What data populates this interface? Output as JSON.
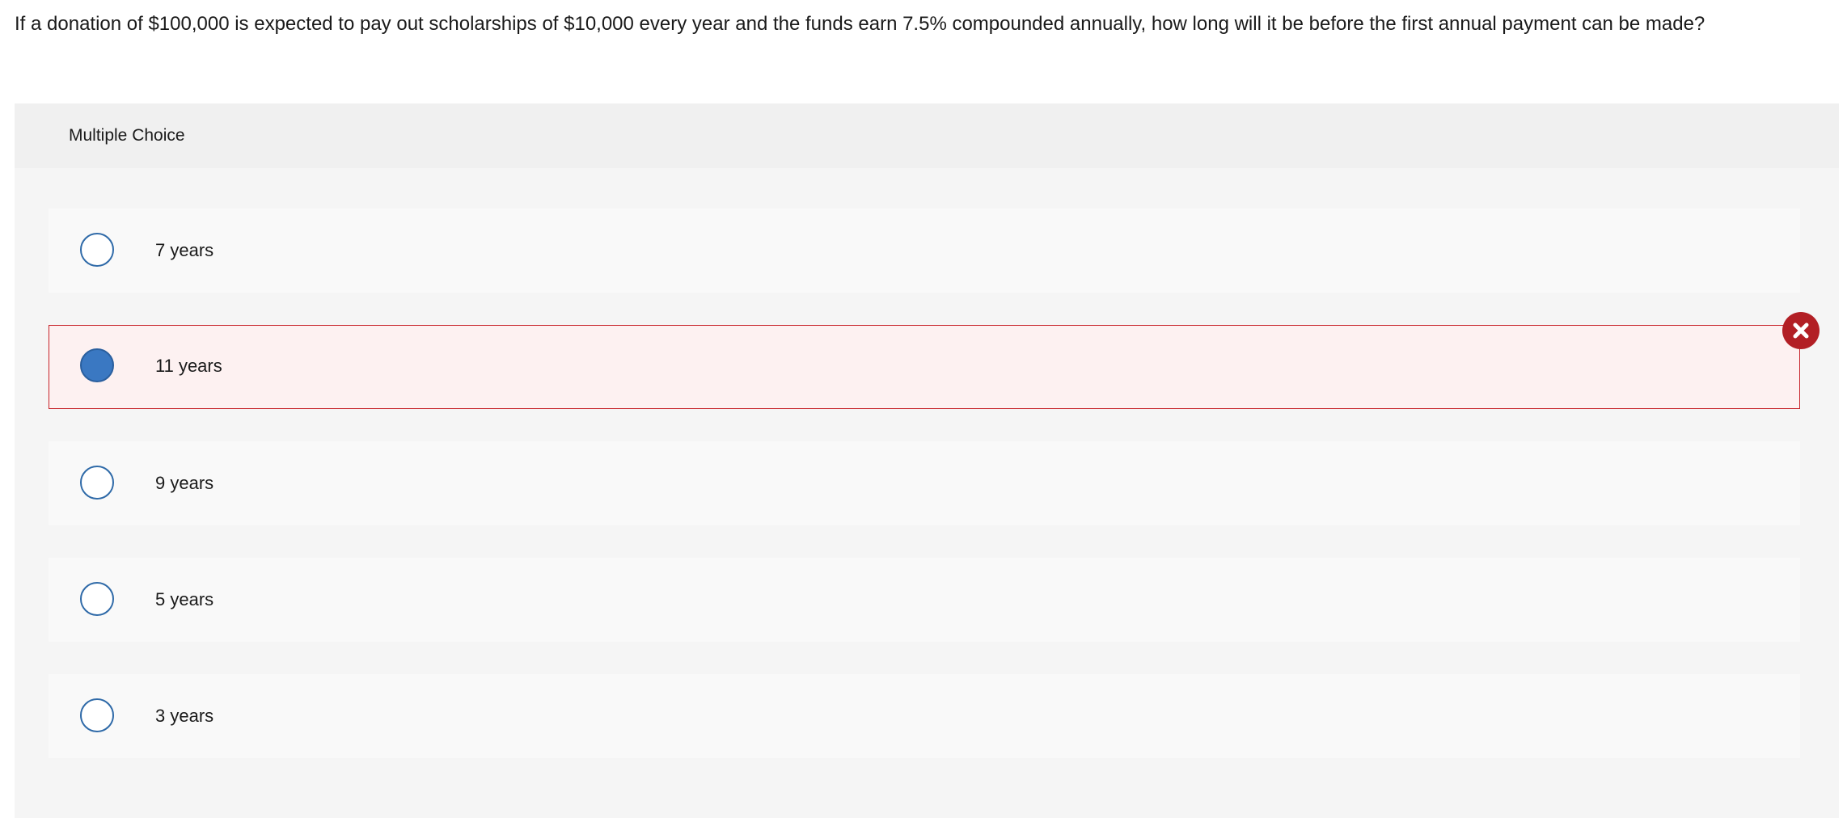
{
  "question": {
    "text": "If a donation of $100,000 is expected to pay out scholarships of $10,000 every year and the funds earn 7.5% compounded annually, how long will it be before the first annual payment can be made?"
  },
  "panel": {
    "title": "Multiple Choice"
  },
  "options": [
    {
      "label": "7 years",
      "selected": false,
      "status": "none"
    },
    {
      "label": "11 years",
      "selected": true,
      "status": "incorrect"
    },
    {
      "label": "9 years",
      "selected": false,
      "status": "none"
    },
    {
      "label": "5 years",
      "selected": false,
      "status": "none"
    },
    {
      "label": "3 years",
      "selected": false,
      "status": "none"
    }
  ],
  "feedback_icon": "close-icon",
  "colors": {
    "incorrect": "#b21f25",
    "radio_selected": "#3a78c2",
    "radio_border": "#2f6aa8"
  }
}
